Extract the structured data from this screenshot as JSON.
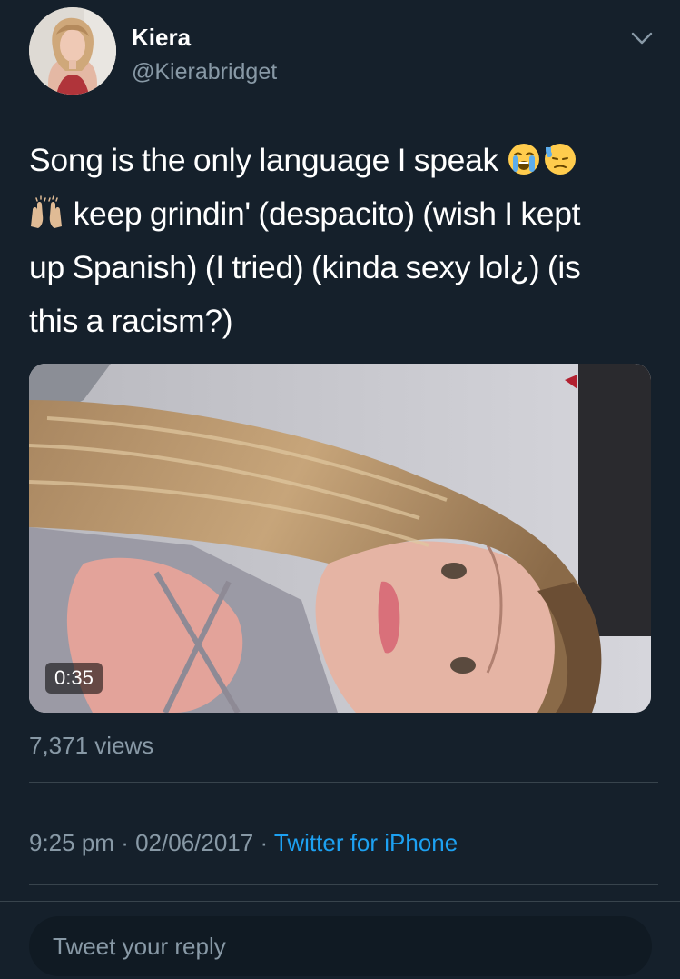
{
  "user": {
    "display_name": "Kiera",
    "handle": "@Kierabridget"
  },
  "icons": {
    "menu": "chevron-down-icon",
    "emoji_1": "loudly-crying-face-emoji",
    "emoji_2": "downcast-face-with-sweat-emoji",
    "emoji_3": "raising-hands-emoji"
  },
  "tweet": {
    "line1": "Song is the only language I speak",
    "line2": "keep grindin' (despacito) (wish I kept",
    "line3": "up Spanish) (I tried) (kinda sexy lol¿) (is",
    "line4": "this a racism?)"
  },
  "video": {
    "duration": "0:35",
    "views": "7,371 views"
  },
  "meta": {
    "time": "9:25 pm",
    "separator": "·",
    "date": "02/06/2017",
    "source": "Twitter for iPhone"
  },
  "reply": {
    "placeholder": "Tweet your reply"
  },
  "colors": {
    "background": "#15202b",
    "secondary_text": "#8899a6",
    "link": "#1da1f2",
    "divider": "#38444d"
  }
}
